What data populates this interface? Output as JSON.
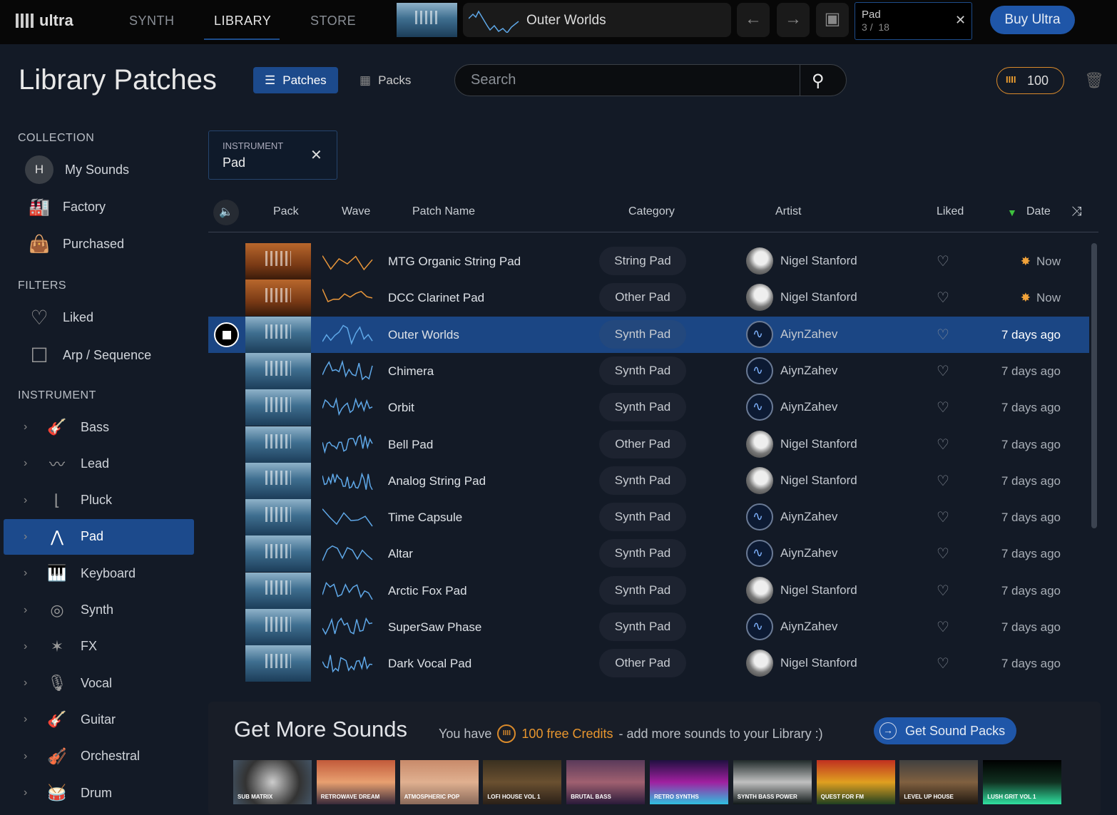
{
  "app": {
    "logo": "ultra",
    "nav": [
      "SYNTH",
      "LIBRARY",
      "STORE"
    ],
    "active_nav": "LIBRARY"
  },
  "topbar": {
    "current_patch": "Outer Worlds",
    "filter_label": "Pad",
    "position": "3",
    "total": "18",
    "position_sep": "/",
    "buy_label": "Buy Ultra"
  },
  "header": {
    "title": "Library Patches",
    "patches_label": "Patches",
    "packs_label": "Packs",
    "search_placeholder": "Search",
    "credits": "100"
  },
  "sidebar": {
    "collection_title": "COLLECTION",
    "collection": [
      {
        "label": "My Sounds",
        "icon": "avatar-h",
        "avatar_letter": "H"
      },
      {
        "label": "Factory",
        "icon": "factory-icon"
      },
      {
        "label": "Purchased",
        "icon": "bag-icon"
      }
    ],
    "filters_title": "FILTERS",
    "filters": [
      {
        "label": "Liked",
        "icon": "heart-icon"
      },
      {
        "label": "Arp / Sequence",
        "icon": "checkbox-icon"
      }
    ],
    "instrument_title": "INSTRUMENT",
    "instruments": [
      {
        "label": "Bass",
        "icon": "bass-guitar-icon"
      },
      {
        "label": "Lead",
        "icon": "lead-wave-icon"
      },
      {
        "label": "Pluck",
        "icon": "pluck-envelope-icon"
      },
      {
        "label": "Pad",
        "icon": "pad-envelope-icon",
        "active": true
      },
      {
        "label": "Keyboard",
        "icon": "keyboard-icon"
      },
      {
        "label": "Synth",
        "icon": "synth-knob-icon"
      },
      {
        "label": "FX",
        "icon": "fx-star-icon"
      },
      {
        "label": "Vocal",
        "icon": "microphone-icon"
      },
      {
        "label": "Guitar",
        "icon": "guitar-icon"
      },
      {
        "label": "Orchestral",
        "icon": "violin-icon"
      },
      {
        "label": "Drum",
        "icon": "drum-icon"
      }
    ]
  },
  "active_filter": {
    "type": "INSTRUMENT",
    "value": "Pad"
  },
  "table": {
    "columns": [
      "Pack",
      "Wave",
      "Patch Name",
      "Category",
      "Artist",
      "Liked",
      "Date"
    ],
    "sort": {
      "column": "Date",
      "direction": "descending"
    },
    "rows": [
      {
        "name": "MTG Organic String Pad",
        "category": "String Pad",
        "artist": "Nigel Stanford",
        "date": "Now",
        "pack": "orange",
        "new": true
      },
      {
        "name": "DCC Clarinet Pad",
        "category": "Other Pad",
        "artist": "Nigel Stanford",
        "date": "Now",
        "pack": "orange",
        "new": true
      },
      {
        "name": "Outer Worlds",
        "category": "Synth Pad",
        "artist": "AiynZahev",
        "date": "7 days ago",
        "pack": "blue",
        "selected": true
      },
      {
        "name": "Chimera",
        "category": "Synth Pad",
        "artist": "AiynZahev",
        "date": "7 days ago",
        "pack": "blue"
      },
      {
        "name": "Orbit",
        "category": "Synth Pad",
        "artist": "AiynZahev",
        "date": "7 days ago",
        "pack": "blue"
      },
      {
        "name": "Bell Pad",
        "category": "Other Pad",
        "artist": "Nigel Stanford",
        "date": "7 days ago",
        "pack": "blue"
      },
      {
        "name": "Analog String Pad",
        "category": "Synth Pad",
        "artist": "Nigel Stanford",
        "date": "7 days ago",
        "pack": "blue"
      },
      {
        "name": "Time Capsule",
        "category": "Synth Pad",
        "artist": "AiynZahev",
        "date": "7 days ago",
        "pack": "blue"
      },
      {
        "name": "Altar",
        "category": "Synth Pad",
        "artist": "AiynZahev",
        "date": "7 days ago",
        "pack": "blue"
      },
      {
        "name": "Arctic Fox Pad",
        "category": "Synth Pad",
        "artist": "Nigel Stanford",
        "date": "7 days ago",
        "pack": "blue"
      },
      {
        "name": "SuperSaw Phase",
        "category": "Synth Pad",
        "artist": "AiynZahev",
        "date": "7 days ago",
        "pack": "blue"
      },
      {
        "name": "Dark Vocal Pad",
        "category": "Other Pad",
        "artist": "Nigel Stanford",
        "date": "7 days ago",
        "pack": "blue"
      }
    ]
  },
  "more": {
    "title": "Get More Sounds",
    "you_have": "You have",
    "credits_text": "100 free Credits",
    "suffix": "- add more sounds to your Library :)",
    "button": "Get Sound Packs",
    "packs": [
      "Sub Matrix",
      "Retrowave Dream",
      "Atmospheric Pop",
      "Lofi House Vol 1",
      "Brutal Bass",
      "Retro Synths",
      "Synth Bass Power",
      "Quest for FM",
      "Level Up House",
      "Lush Grit Vol 1"
    ]
  },
  "colors": {
    "accent": "#1f56a8",
    "credits": "#d98a2b",
    "selected_row": "#1b4684",
    "wave": "#5fa8e8",
    "wave_new": "#e8963a"
  }
}
